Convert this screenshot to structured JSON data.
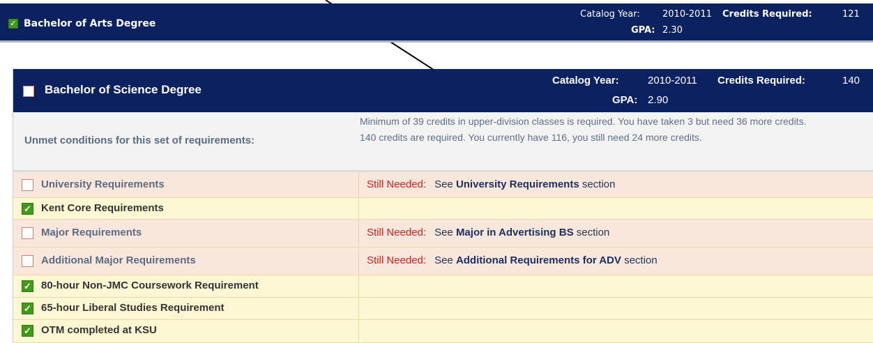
{
  "ba": {
    "title": "Bachelor of Arts Degree",
    "checked": true,
    "catalog_year_label": "Catalog Year:",
    "catalog_year": "2010-2011",
    "credits_required_label": "Credits Required:",
    "credits_required": "121",
    "gpa_label": "GPA:",
    "gpa": "2.30"
  },
  "bs": {
    "title": "Bachelor of Science Degree",
    "checked": false,
    "catalog_year_label": "Catalog Year:",
    "catalog_year": "2010-2011",
    "credits_required_label": "Credits Required:",
    "credits_required": "140",
    "gpa_label": "GPA:",
    "gpa": "2.90"
  },
  "unmet": {
    "label": "Unmet conditions for this set of requirements:",
    "messages": [
      "Minimum of 39 credits in upper-division classes is required. You have taken 3 but need 36 more credits.",
      "140 credits are required. You currently have 116, you still need 24 more credits."
    ]
  },
  "requirements": [
    {
      "name": "University Requirements",
      "met": false,
      "still_needed": "Still Needed:",
      "see": "See",
      "section": "University Requirements",
      "suffix": "section"
    },
    {
      "name": "Kent Core Requirements",
      "met": true
    },
    {
      "name": "Major Requirements",
      "met": false,
      "still_needed": "Still Needed:",
      "see": "See",
      "section": "Major in Advertising BS",
      "suffix": "section"
    },
    {
      "name": "Additional Major Requirements",
      "met": false,
      "still_needed": "Still Needed:",
      "see": "See",
      "section": "Additional Requirements for ADV",
      "suffix": "section"
    },
    {
      "name": "80-hour Non-JMC Coursework Requirement",
      "met": true
    },
    {
      "name": "65-hour Liberal Studies Requirement",
      "met": true
    },
    {
      "name": "OTM completed at KSU",
      "met": true
    }
  ],
  "colors": {
    "header_bg": "#0c2260",
    "check_green": "#3f9b18",
    "still_needed_red": "#d42020",
    "unmet_row_bg": "#fae7db",
    "met_row_bg": "#fdf8d3"
  },
  "icons": {
    "checked": "checkbox-checked-icon",
    "unchecked": "checkbox-unchecked-icon",
    "annotation": "arrow-annotation"
  }
}
